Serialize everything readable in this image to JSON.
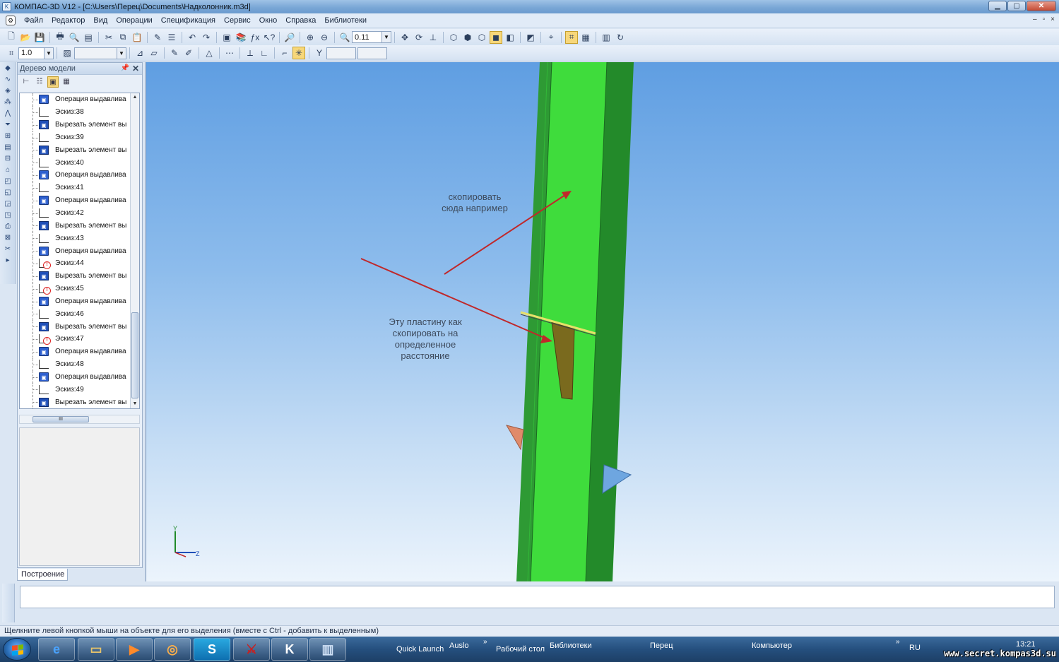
{
  "window": {
    "title": "КОМПАС-3D V12 - [C:\\Users\\Перец\\Documents\\Надколонник.m3d]",
    "min_symbol": "▁",
    "max_symbol": "▢",
    "close_symbol": "✕"
  },
  "menu": {
    "items": [
      "Файл",
      "Редактор",
      "Вид",
      "Операции",
      "Спецификация",
      "Сервис",
      "Окно",
      "Справка",
      "Библиотеки"
    ],
    "mdi_controls": [
      "‒",
      "▫",
      "×"
    ]
  },
  "toolbar1": {
    "zoom_value": "0.11"
  },
  "toolbar2": {
    "step_value": "1.0"
  },
  "model_tree": {
    "title": "Дерево модели",
    "tab_label": "Построение",
    "items": [
      {
        "label": "Операция выдавлива",
        "type": "extrude"
      },
      {
        "label": "Эскиз:38",
        "type": "sketch"
      },
      {
        "label": "Вырезать элемент вы",
        "type": "cut"
      },
      {
        "label": "Эскиз:39",
        "type": "sketch"
      },
      {
        "label": "Вырезать элемент вы",
        "type": "cut"
      },
      {
        "label": "Эскиз:40",
        "type": "sketch"
      },
      {
        "label": "Операция выдавлива",
        "type": "extrude"
      },
      {
        "label": "Эскиз:41",
        "type": "sketch"
      },
      {
        "label": "Операция выдавлива",
        "type": "extrude"
      },
      {
        "label": "Эскиз:42",
        "type": "sketch"
      },
      {
        "label": "Вырезать элемент вы",
        "type": "cut"
      },
      {
        "label": "Эскиз:43",
        "type": "sketch"
      },
      {
        "label": "Операция выдавлива",
        "type": "extrude"
      },
      {
        "label": "Эскиз:44",
        "type": "sketch-err"
      },
      {
        "label": "Вырезать элемент вы",
        "type": "cut"
      },
      {
        "label": "Эскиз:45",
        "type": "sketch-err"
      },
      {
        "label": "Операция выдавлива",
        "type": "extrude"
      },
      {
        "label": "Эскиз:46",
        "type": "sketch"
      },
      {
        "label": "Вырезать элемент вы",
        "type": "cut"
      },
      {
        "label": "Эскиз:47",
        "type": "sketch-err"
      },
      {
        "label": "Операция выдавлива",
        "type": "extrude"
      },
      {
        "label": "Эскиз:48",
        "type": "sketch"
      },
      {
        "label": "Операция выдавлива",
        "type": "extrude"
      },
      {
        "label": "Эскиз:49",
        "type": "sketch"
      },
      {
        "label": "Вырезать элемент вы",
        "type": "cut"
      }
    ],
    "hscroll_grip": "III"
  },
  "viewport": {
    "annotation_top": [
      "скопировать",
      "сюда например"
    ],
    "annotation_mid": [
      "Эту пластину как",
      "скопировать  на",
      "определенное",
      "расстояние"
    ],
    "axis_y": "Y",
    "axis_z": "Z",
    "colors": {
      "beam_front": "#3fdc3c",
      "beam_side": "#238a2a",
      "arrow": "#c0282a",
      "plate": "#7a6a1e",
      "plate_edge": "#e8e06a"
    }
  },
  "status": {
    "text": "Щелкните левой кнопкой мыши на объекте для его выделения (вместе с Ctrl - добавить к выделенным)"
  },
  "taskbar": {
    "quick_launch": "Quick Launch",
    "auslo": "Auslo",
    "desktop": "Рабочий стол",
    "libraries": "Библиотеки",
    "perets": "Перец",
    "computer": "Компьютер",
    "lang": "RU",
    "time": "13:21",
    "chevron": "»"
  },
  "watermark": "www.secret.kompas3d.su"
}
